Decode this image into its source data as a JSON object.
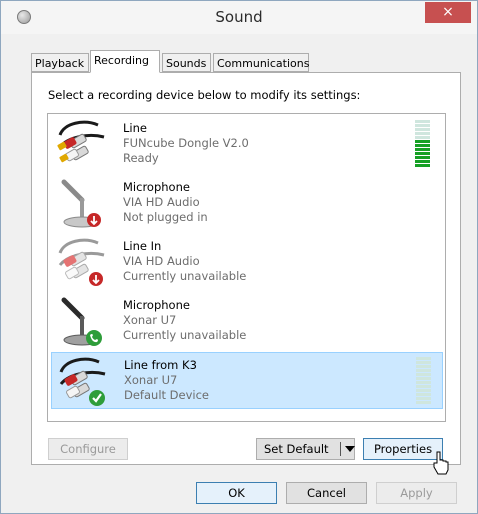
{
  "window": {
    "title": "Sound",
    "close_label": "×"
  },
  "tabs": [
    {
      "label": "Playback"
    },
    {
      "label": "Recording"
    },
    {
      "label": "Sounds"
    },
    {
      "label": "Communications"
    }
  ],
  "active_tab": "Recording",
  "instruction": "Select a recording device below to modify its settings:",
  "devices": [
    {
      "name": "Line",
      "driver": "FUNcube Dongle V2.0",
      "status": "Ready",
      "icon": "line-in-jack-icon",
      "level_fraction": 0.55,
      "selected": false
    },
    {
      "name": "Microphone",
      "driver": "VIA HD Audio",
      "status": "Not plugged in",
      "icon": "microphone-icon",
      "badge": "unplugged-red-arrow-icon",
      "selected": false
    },
    {
      "name": "Line In",
      "driver": "VIA HD Audio",
      "status": "Currently unavailable",
      "icon": "line-in-jack-icon",
      "badge": "unplugged-red-arrow-icon",
      "selected": false
    },
    {
      "name": "Microphone",
      "driver": "Xonar U7",
      "status": "Currently unavailable",
      "icon": "microphone-icon",
      "badge": "phone-green-icon",
      "selected": false
    },
    {
      "name": "Line from K3",
      "driver": "Xonar U7",
      "status": "Default Device",
      "icon": "line-in-jack-icon",
      "badge": "green-check-icon",
      "level_fraction": 0.0,
      "selected": true
    }
  ],
  "buttons": {
    "configure": "Configure",
    "set_default": "Set Default",
    "properties": "Properties",
    "ok": "OK",
    "cancel": "Cancel",
    "apply": "Apply"
  },
  "colors": {
    "selection_bg": "#cce8ff",
    "close_bg": "#c75050",
    "level_on": "#16a025"
  }
}
